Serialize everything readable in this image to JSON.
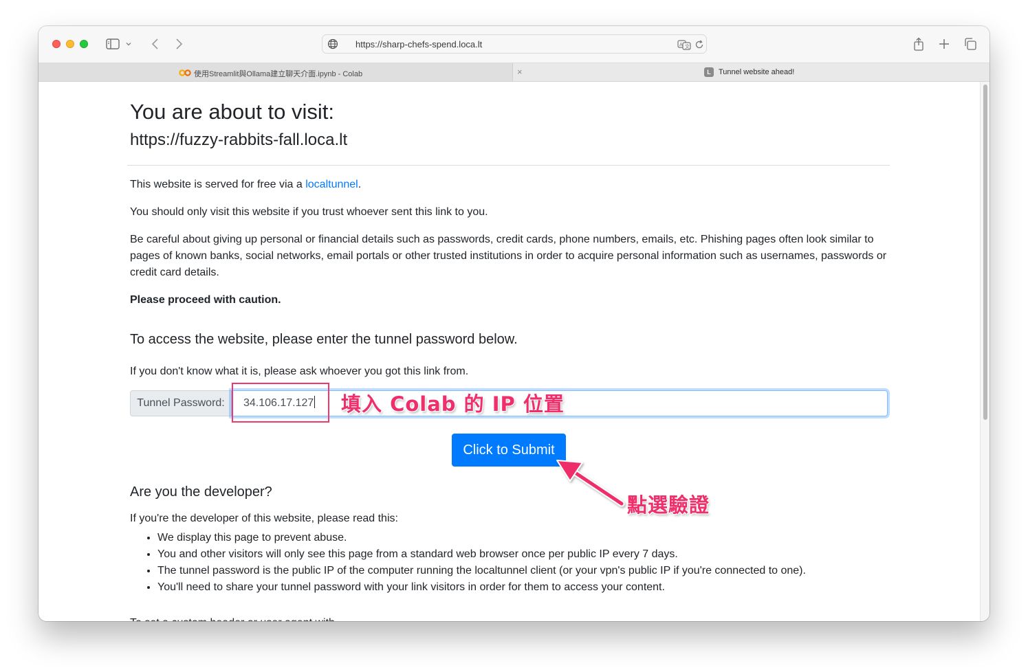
{
  "browser": {
    "url": "https://sharp-chefs-spend.loca.lt",
    "tabs": [
      {
        "title": "使用Streamlit與Ollama建立聊天介面.ipynb - Colab",
        "icon": "colab-icon",
        "active": false
      },
      {
        "title": "Tunnel website ahead!",
        "icon": "l-favicon",
        "favicon_letter": "L",
        "active": true
      }
    ],
    "close_glyph": "×"
  },
  "page": {
    "title": "You are about to visit:",
    "visit_url": "https://fuzzy-rabbits-fall.loca.lt",
    "served_prefix": "This website is served for free via a ",
    "served_link": "localtunnel",
    "served_suffix": ".",
    "trust_text": "You should only visit this website if you trust whoever sent this link to you.",
    "careful_text": "Be careful about giving up personal or financial details such as passwords, credit cards, phone numbers, emails, etc. Phishing pages often look similar to pages of known banks, social networks, email portals or other trusted institutions in order to acquire personal information such as usernames, passwords or credit card details.",
    "caution_text": "Please proceed with caution.",
    "access_heading": "To access the website, please enter the tunnel password below.",
    "ask_text": "If you don't know what it is, please ask whoever you got this link from.",
    "password_label": "Tunnel Password:",
    "password_value": "34.106.17.127",
    "submit_label": "Click to Submit",
    "developer_heading": "Are you the developer?",
    "developer_text": "If you're the developer of this website, please read this:",
    "developer_items": [
      "We display this page to prevent abuse.",
      "You and other visitors will only see this page from a standard web browser once per public IP every 7 days.",
      "The tunnel password is the public IP of the computer running the localtunnel client (or your vpn's public IP if you're connected to one).",
      "You'll need to share your tunnel password with your link visitors in order for them to access your content."
    ],
    "cutoff_text": "To set a custom header or user agent with"
  },
  "annotations": {
    "input_note": "填入 Colab 的 IP 位置",
    "button_note": "點選驗證",
    "color": "#ee2f6b"
  },
  "colors": {
    "primary": "#007bff",
    "link": "#007bff",
    "text": "#212529"
  }
}
